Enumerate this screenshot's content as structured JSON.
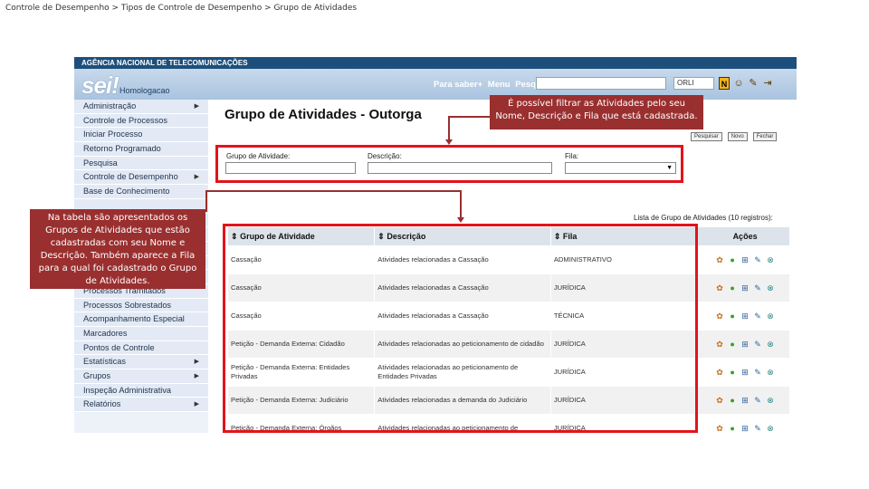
{
  "breadcrumb": "Controle de Desempenho > Tipos de Controle de Desempenho > Grupo de Atividades",
  "top_strip": "AGÊNCIA NACIONAL DE TELECOMUNICAÇÕES",
  "header": {
    "logo": "sei!",
    "environment": "Homologacao",
    "menu": [
      "Para saber+",
      "Menu",
      "Pesquisa"
    ],
    "unit": "ORLI",
    "n_badge": "N"
  },
  "sidebar": {
    "items": [
      {
        "label": "Administração",
        "submenu": true
      },
      {
        "label": "Controle de Processos",
        "submenu": false
      },
      {
        "label": "Iniciar Processo",
        "submenu": false
      },
      {
        "label": "Retorno Programado",
        "submenu": false
      },
      {
        "label": "Pesquisa",
        "submenu": false
      },
      {
        "label": "Controle de Desempenho",
        "submenu": true
      },
      {
        "label": "Base de Conhecimento",
        "submenu": false
      },
      {
        "label": "",
        "submenu": false
      },
      {
        "label": "",
        "submenu": false
      },
      {
        "label": "",
        "submenu": false
      },
      {
        "label": "",
        "submenu": false
      },
      {
        "label": "",
        "submenu": false
      },
      {
        "label": "",
        "submenu": false
      },
      {
        "label": "Processos Tramitados Externamente",
        "submenu": false
      },
      {
        "label": "Processos Sobrestados",
        "submenu": false
      },
      {
        "label": "Acompanhamento Especial",
        "submenu": false
      },
      {
        "label": "Marcadores",
        "submenu": false
      },
      {
        "label": "Pontos de Controle",
        "submenu": false
      },
      {
        "label": "Estatísticas",
        "submenu": true
      },
      {
        "label": "Grupos",
        "submenu": true
      },
      {
        "label": "Inspeção Administrativa",
        "submenu": false
      },
      {
        "label": "Relatórios",
        "submenu": true
      }
    ]
  },
  "page_title": "Grupo de Atividades - Outorga",
  "buttons": {
    "pesquisar": "Pesquisar",
    "novo": "Novo",
    "fechar": "Fechar"
  },
  "filters": {
    "grupo_label": "Grupo de Atividade:",
    "descricao_label": "Descrição:",
    "fila_label": "Fila:",
    "grupo_value": "",
    "descricao_value": "",
    "fila_value": ""
  },
  "table": {
    "caption": "Lista de Grupo de Atividades (10 registros):",
    "headers": [
      "Grupo de Atividade",
      "Descrição",
      "Fila",
      "Ações"
    ],
    "rows": [
      {
        "grupo": "Cassação",
        "descricao": "Atividades relacionadas a Cassação",
        "fila": "ADMINISTRATIVO"
      },
      {
        "grupo": "Cassação",
        "descricao": "Atividades relacionadas a Cassação",
        "fila": "JURÍDICA"
      },
      {
        "grupo": "Cassação",
        "descricao": "Atividades relacionadas a Cassação",
        "fila": "TÉCNICA"
      },
      {
        "grupo": "Petição - Demanda Externa: Cidadão",
        "descricao": "Atividades relacionadas ao peticionamento de cidadão",
        "fila": "JURÍDICA"
      },
      {
        "grupo": "Petição - Demanda Externa: Entidades Privadas",
        "descricao": "Atividades relacionadas ao peticionamento de Entidades Privadas",
        "fila": "JURÍDICA"
      },
      {
        "grupo": "Petição - Demanda Externa: Judiciário",
        "descricao": "Atividades relacionadas a demanda do Judiciário",
        "fila": "JURÍDICA"
      },
      {
        "grupo": "Petição - Demanda Externa: Órgãos",
        "descricao": "Atividades relacionadas ao peticionamento de",
        "fila": "JURÍDICA"
      }
    ]
  },
  "callouts": {
    "filter_note": "É possível filtrar as Atividades pelo seu Nome, Descrição e Fila que está cadastrada.",
    "table_note": "Na tabela são apresentados os Grupos de Atividades que estão cadastradas com seu Nome e Descrição. Também aparece a Fila para a qual foi cadastrado o Grupo de Atividades."
  },
  "colors": {
    "annotation_red": "#e3131b",
    "callout_bg": "#9a2f2f",
    "header_blue": "#1d4f7c"
  }
}
